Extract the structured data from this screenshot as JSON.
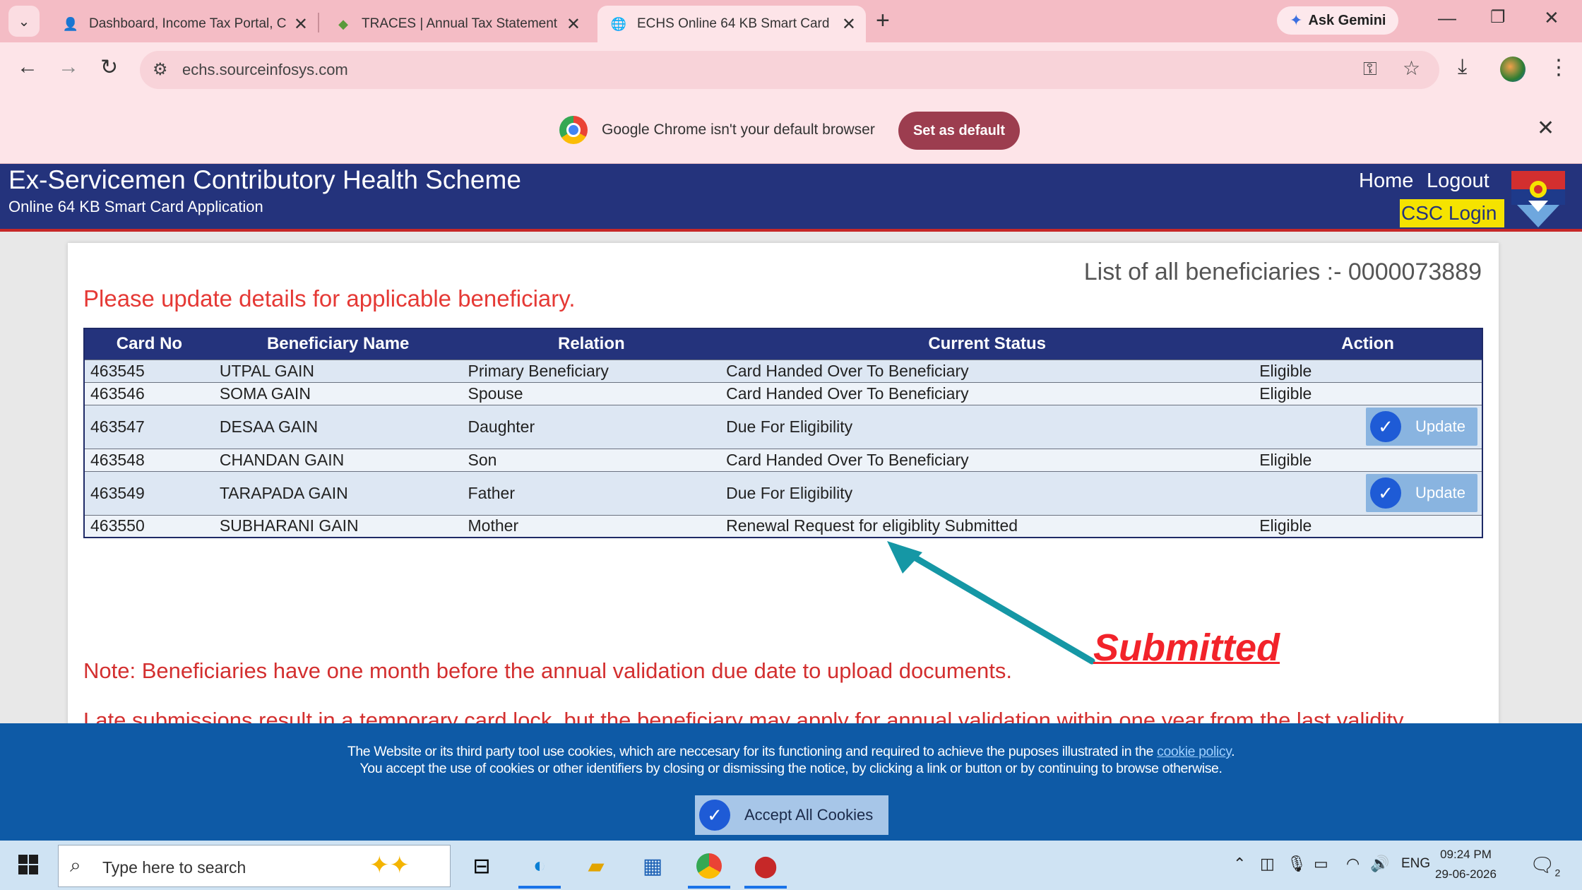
{
  "browser": {
    "tabs": [
      {
        "title": "Dashboard, Income Tax Portal, C",
        "icon": "income-tax-favicon"
      },
      {
        "title": "TRACES | Annual Tax Statement",
        "icon": "traces-favicon"
      },
      {
        "title": "ECHS Online 64 KB Smart Card",
        "icon": "globe-icon",
        "active": true
      }
    ],
    "ask_gemini": "Ask Gemini",
    "url": "echs.sourceinfosys.com",
    "infobar": {
      "message": "Google Chrome isn't your default browser",
      "button": "Set as default"
    }
  },
  "site": {
    "title": "Ex-Servicemen Contributory Health Scheme",
    "subtitle": "Online 64 KB Smart Card Application",
    "nav": {
      "home": "Home",
      "logout": "Logout",
      "csc_login": "CSC Login"
    },
    "colors": {
      "header": "#24337c",
      "accent_red": "#e53935",
      "csc": "#f5e300"
    }
  },
  "main": {
    "list_title": "List of all beneficiaries :- 0000073889",
    "update_message": "Please update details for applicable beneficiary.",
    "table": {
      "headers": [
        "Card No",
        "Beneficiary Name",
        "Relation",
        "Current Status",
        "Action"
      ],
      "rows": [
        {
          "card": "463545",
          "name": "UTPAL GAIN",
          "relation": "Primary Beneficiary",
          "status": "Card Handed Over To Beneficiary",
          "action": "Eligible"
        },
        {
          "card": "463546",
          "name": "SOMA GAIN",
          "relation": "Spouse",
          "status": "Card Handed Over To Beneficiary",
          "action": "Eligible"
        },
        {
          "card": "463547",
          "name": "DESAA GAIN",
          "relation": "Daughter",
          "status": "Due For Eligibility",
          "action": "Update"
        },
        {
          "card": "463548",
          "name": "CHANDAN GAIN",
          "relation": "Son",
          "status": "Card Handed Over To Beneficiary",
          "action": "Eligible"
        },
        {
          "card": "463549",
          "name": "TARAPADA GAIN",
          "relation": "Father",
          "status": "Due For Eligibility",
          "action": "Update"
        },
        {
          "card": "463550",
          "name": "SUBHARANI GAIN",
          "relation": "Mother",
          "status": "Renewal Request for eligiblity Submitted",
          "action": "Eligible"
        }
      ]
    },
    "note": "Note: Beneficiaries have one month before the annual validation due date to upload documents.",
    "note2": "Late submissions result in a temporary card lock, but the beneficiary may apply for annual validation within one year from the last validity",
    "annotation": "Submitted"
  },
  "cookie": {
    "line1": "The Website or its third party tool use cookies, which are neccesary for its functioning and required to achieve the puposes illustrated in the",
    "link": "cookie policy",
    "line2": "You accept the use of cookies or other identifiers by closing or dismissing the notice, by clicking a link or button or by continuing to browse otherwise.",
    "button": "Accept All Cookies"
  },
  "taskbar": {
    "search_placeholder": "Type here to search",
    "lang": "ENG",
    "time": "09:24 PM",
    "date": "29-06-2026",
    "notification_count": "2"
  }
}
